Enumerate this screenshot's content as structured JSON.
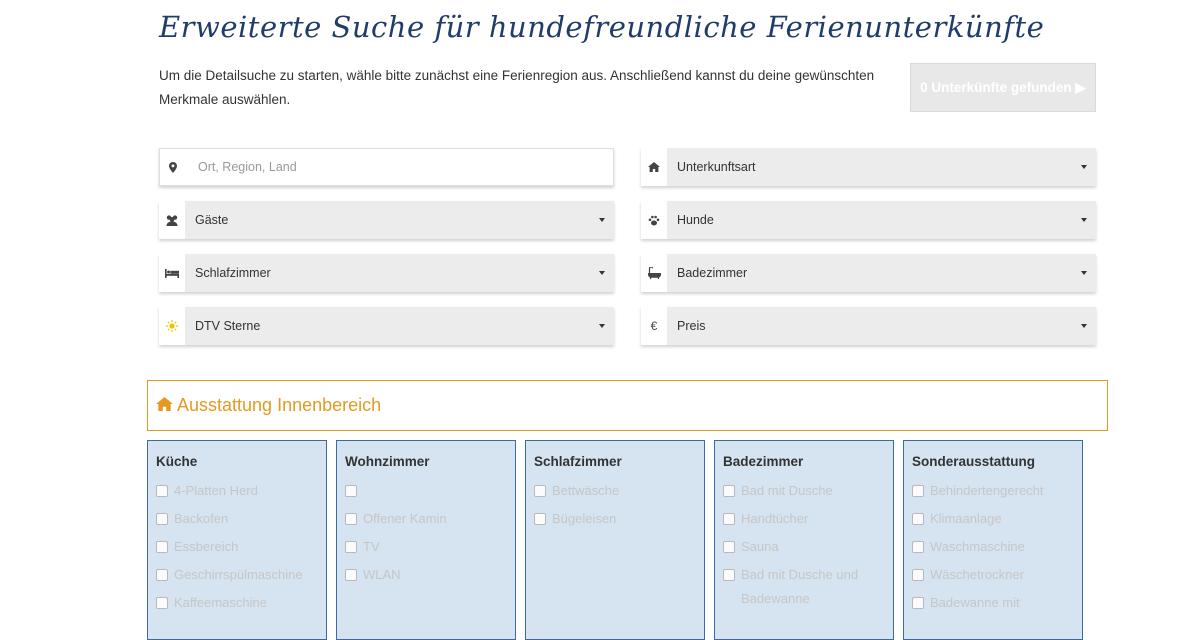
{
  "header": {
    "title": "Erweiterte Suche für hundefreundliche Ferienunterkünfte",
    "intro": "Um die Detailsuche zu starten, wähle bitte zunächst eine Ferienregion aus. Anschließend kannst du deine gewünschten Merkmale auswählen.",
    "found_button": "0 Unterkünfte gefunden ▶"
  },
  "filters": {
    "location_placeholder": "Ort, Region, Land",
    "accommodation_type": "Unterkunftsart",
    "guests": "Gäste",
    "dogs": "Hunde",
    "bedrooms": "Schlafzimmer",
    "bathrooms": "Badezimmer",
    "dtv_stars": "DTV Sterne",
    "price": "Preis",
    "euro_symbol": "€"
  },
  "section": {
    "title": "Ausstattung Innenbereich",
    "icon": "home-icon",
    "accent_color": "#e49a1e"
  },
  "columns": [
    {
      "title": "Küche",
      "items": [
        "4-Platten Herd",
        "Backofen",
        "Essbereich",
        "Geschirrspülmaschine",
        "Kaffeemaschine"
      ]
    },
    {
      "title": "Wohnzimmer",
      "items": [
        "",
        "Offener Kamin",
        "TV",
        "WLAN"
      ]
    },
    {
      "title": "Schlafzimmer",
      "items": [
        "Bettwäsche",
        "Bügeleisen"
      ]
    },
    {
      "title": "Badezimmer",
      "items": [
        "Bad mit Dusche",
        "Handtücher",
        "Sauna",
        "Bad mit Dusche und Badewanne"
      ]
    },
    {
      "title": "Sonderausstattung",
      "items": [
        "Behindertengerecht",
        "Klimaanlage",
        "Waschmaschine",
        "Wäschetrockner",
        "Badewanne mit"
      ]
    }
  ],
  "colors": {
    "title": "#1f3c6b",
    "column_bg": "#d6e3f0",
    "column_border": "#3f6a9c"
  }
}
